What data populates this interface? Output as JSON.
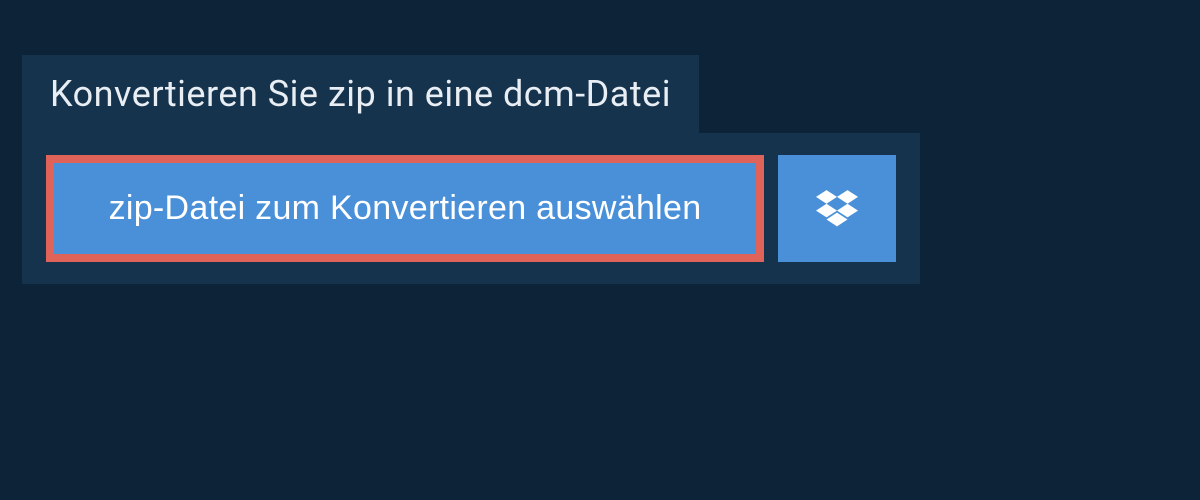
{
  "header": {
    "title": "Konvertieren Sie zip in eine dcm-Datei"
  },
  "upload": {
    "select_file_label": "zip-Datei zum Konvertieren auswählen"
  }
}
